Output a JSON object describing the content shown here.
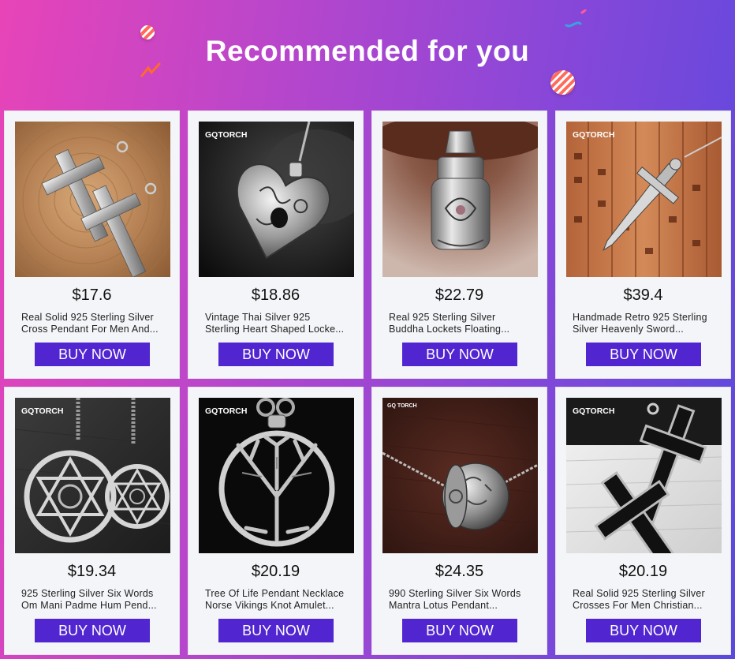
{
  "header": {
    "title": "Recommended for you"
  },
  "colors": {
    "button": "#5125d0",
    "card_bg": "#f4f5f8",
    "gradient_left": "#e844b8",
    "gradient_right": "#5a49de"
  },
  "products": [
    {
      "price": "$17.6",
      "name_line1": "Real Solid 925 Sterling Silver",
      "name_line2": "Cross Pendant For Men And...",
      "button": "BUY NOW",
      "image": "silver-cross-pendants-on-wood",
      "brand": ""
    },
    {
      "price": "$18.86",
      "name_line1": "Vintage Thai Silver 925",
      "name_line2": "Sterling Heart Shaped Locke...",
      "button": "BUY NOW",
      "image": "heart-locket-pendant",
      "brand": "GQTORCH"
    },
    {
      "price": "$22.79",
      "name_line1": "Real 925 Sterling Silver",
      "name_line2": "Buddha Lockets Floating...",
      "button": "BUY NOW",
      "image": "buddha-lotus-locket",
      "brand": ""
    },
    {
      "price": "$39.4",
      "name_line1": "Handmade Retro 925 Sterling",
      "name_line2": "Silver Heavenly Sword...",
      "button": "BUY NOW",
      "image": "sword-pendant-on-bamboo",
      "brand": "GQTORCH"
    },
    {
      "price": "$19.34",
      "name_line1": "925 Sterling Silver Six Words",
      "name_line2": "Om Mani Padme Hum Pend...",
      "button": "BUY NOW",
      "image": "hexagram-pendants",
      "brand": "GQTORCH"
    },
    {
      "price": "$20.19",
      "name_line1": "Tree Of Life Pendant Necklace",
      "name_line2": "Norse Vikings Knot Amulet...",
      "button": "BUY NOW",
      "image": "tree-of-life-pendant",
      "brand": "GQTORCH"
    },
    {
      "price": "$24.35",
      "name_line1": "990 Sterling Silver Six Words",
      "name_line2": "Mantra Lotus Pendant...",
      "button": "BUY NOW",
      "image": "mantra-ball-pendant",
      "brand": "GQ TORCH"
    },
    {
      "price": "$20.19",
      "name_line1": "Real Solid 925 Sterling Silver",
      "name_line2": "Crosses For Men Christian...",
      "button": "BUY NOW",
      "image": "black-enamel-crosses",
      "brand": "GQTORCH"
    }
  ]
}
